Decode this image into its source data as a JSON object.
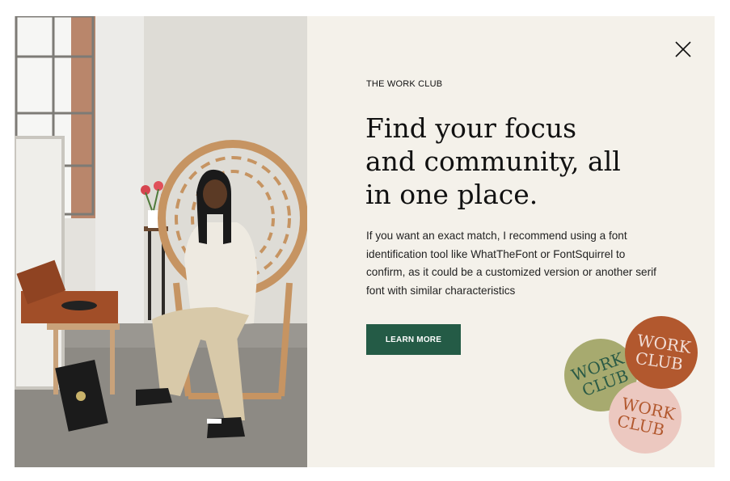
{
  "modal": {
    "close_icon": "close-icon",
    "eyebrow": "THE WORK CLUB",
    "headline_lines": [
      "Find your focus",
      "and community, all",
      "in one place."
    ],
    "body": "If you want an exact match, I recommend using a font identification tool like WhatTheFont or FontSquirrel to confirm, as it could be a customized version or another serif font with similar characteristics",
    "cta_label": "LEARN MORE",
    "stickers": [
      {
        "line1": "WORK",
        "line2": "CLUB",
        "fill": "#a7aa6f",
        "text_color": "#2a5a46"
      },
      {
        "line1": "WORK",
        "line2": "CLUB",
        "fill": "#b2582e",
        "text_color": "#f1ddd6"
      },
      {
        "line1": "WORK",
        "line2": "CLUB",
        "fill": "#ecc8c0",
        "text_color": "#b2582e"
      }
    ]
  },
  "colors": {
    "panel_bg": "#f4f1ea",
    "cta_bg": "#245b46",
    "text": "#111111"
  }
}
